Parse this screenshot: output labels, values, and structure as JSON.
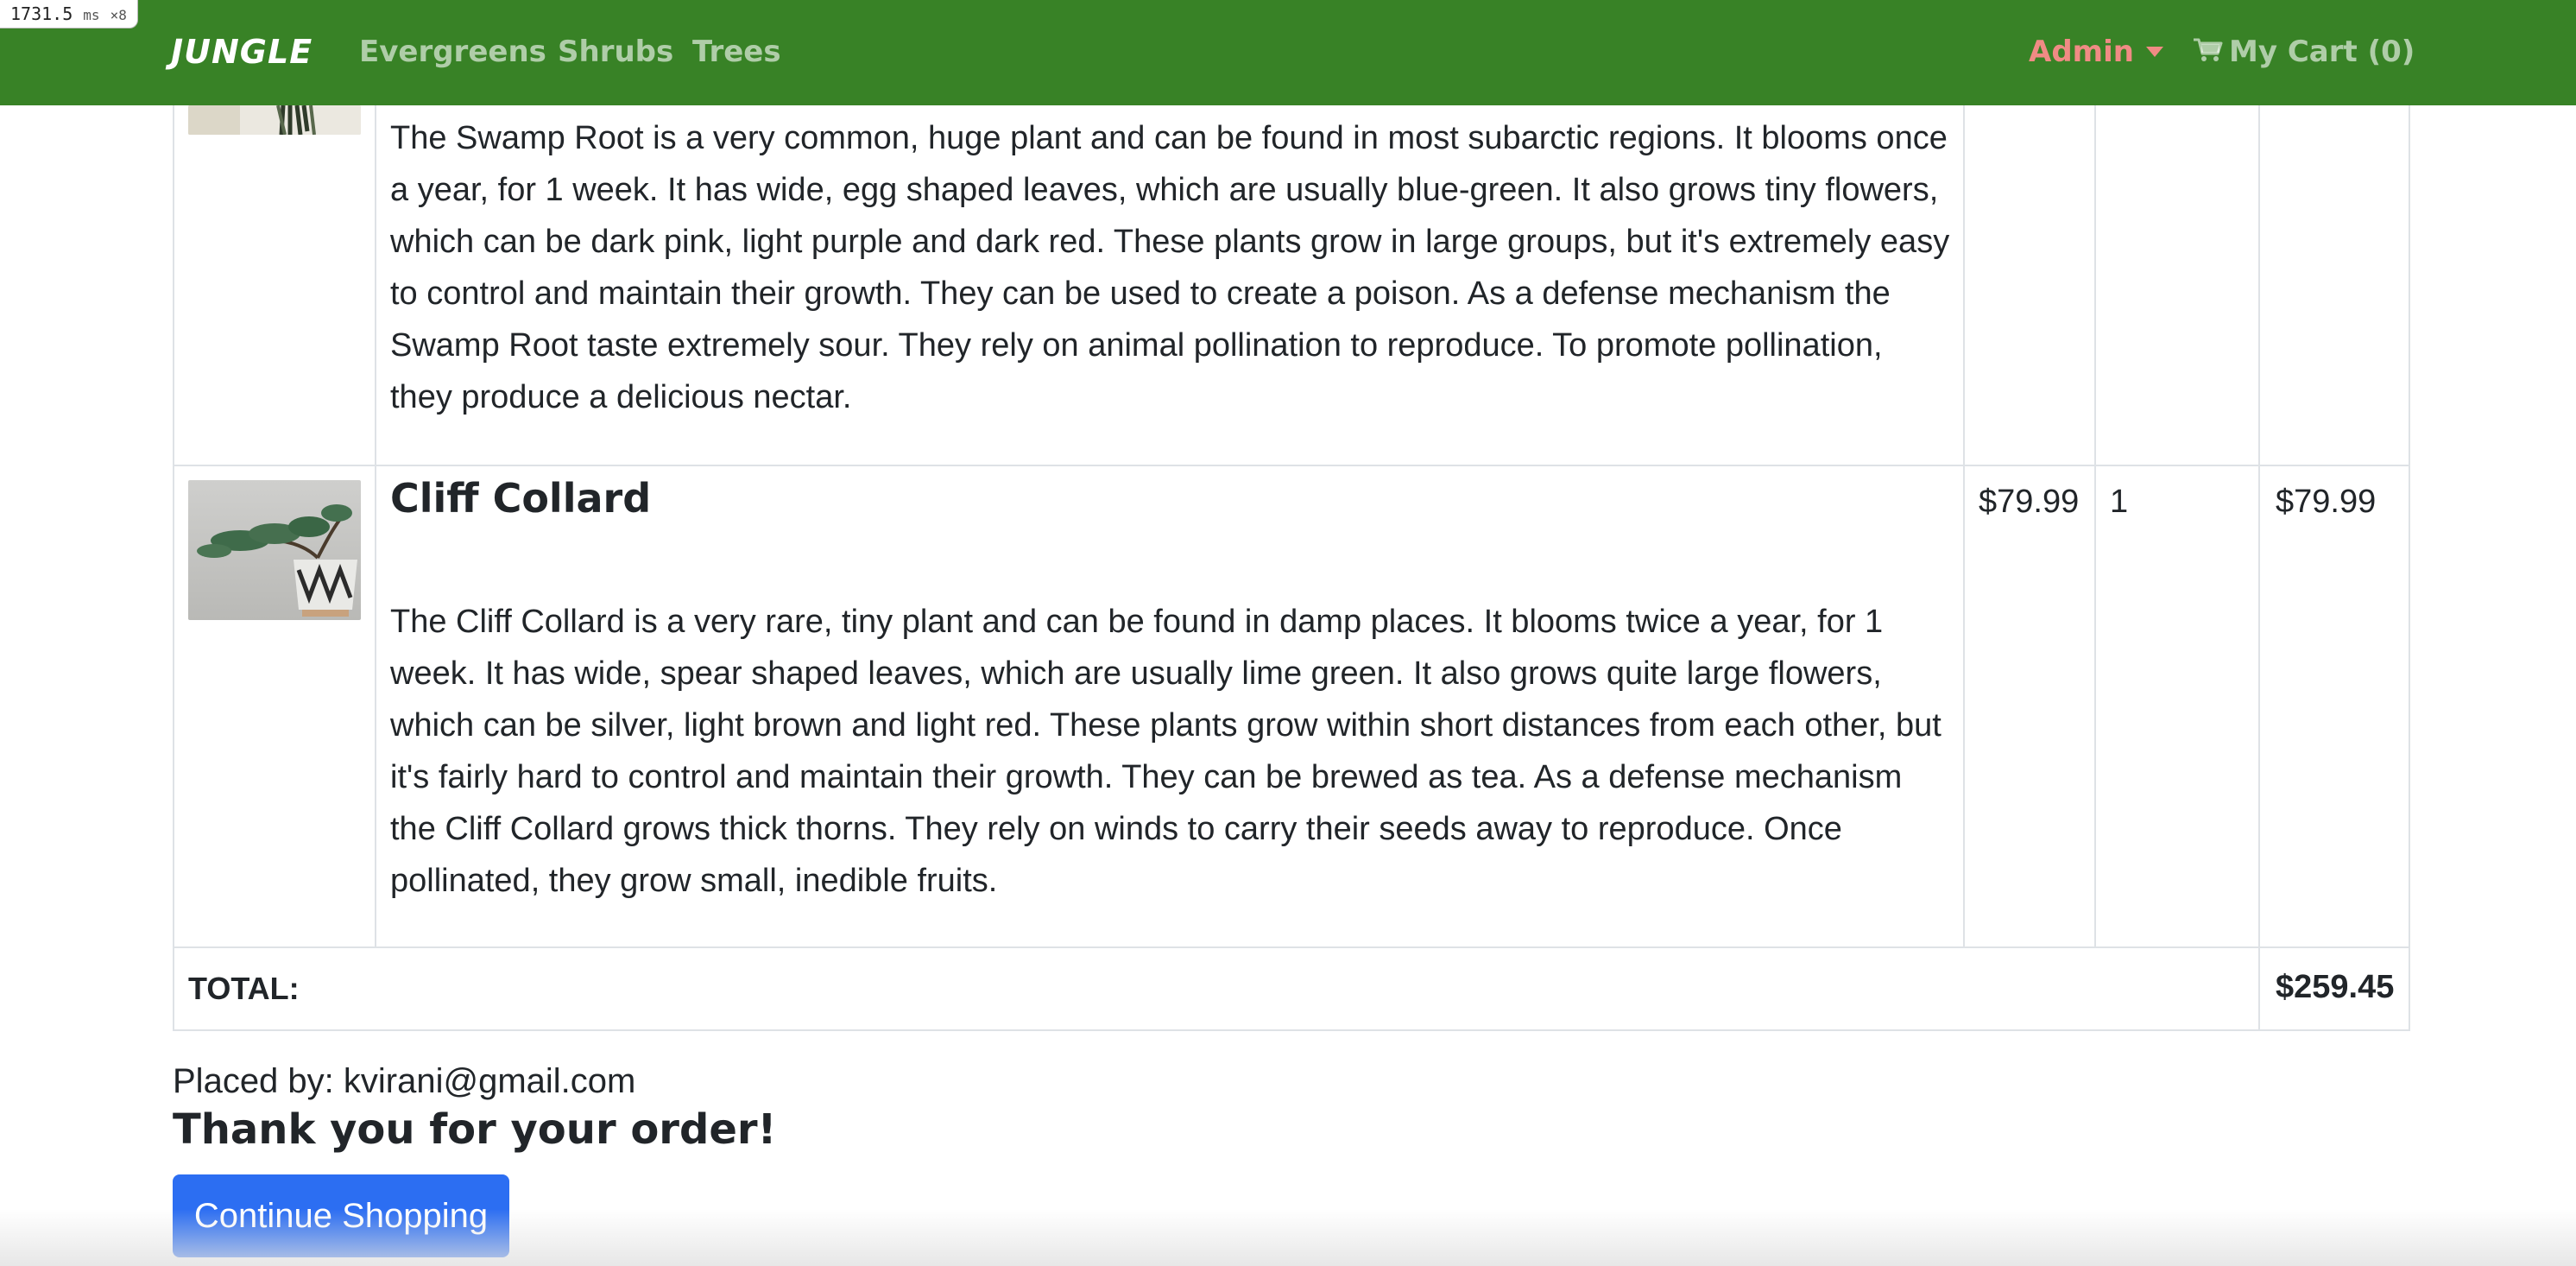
{
  "timing": {
    "value": "1731.5",
    "unit": "ms",
    "multiplier": "×8"
  },
  "navbar": {
    "brand": "JUNGLE",
    "links": [
      "Evergreens",
      "Shrubs",
      "Trees"
    ],
    "admin_label": "Admin",
    "cart_label": "My Cart (0)"
  },
  "order": {
    "items": [
      {
        "description": "The Swamp Root is a very common, huge plant and can be found in most subarctic regions. It blooms once a year, for 1 week. It has wide, egg shaped leaves, which are usually blue-green. It also grows tiny flowers, which can be dark pink, light purple and dark red. These plants grow in large groups, but it's extremely easy to control and maintain their growth. They can be used to create a poison. As a defense mechanism the Swamp Root taste extremely sour. They rely on animal pollination to reproduce. To promote pollination, they produce a delicious nectar."
      },
      {
        "name": "Cliff Collard",
        "description": "The Cliff Collard is a very rare, tiny plant and can be found in damp places. It blooms twice a year, for 1 week. It has wide, spear shaped leaves, which are usually lime green. It also grows quite large flowers, which can be silver, light brown and light red. These plants grow within short distances from each other, but it's fairly hard to control and maintain their growth. They can be brewed as tea. As a defense mechanism the Cliff Collard grows thick thorns. They rely on winds to carry their seeds away to reproduce. Once pollinated, they grow small, inedible fruits.",
        "price": "$79.99",
        "quantity": "1",
        "line_total": "$79.99"
      }
    ],
    "total_label": "TOTAL:",
    "total_value": "$259.45",
    "placed_by": "Placed by: kvirani@gmail.com",
    "thank_you": "Thank you for your order!",
    "continue_button": "Continue Shopping"
  },
  "colors": {
    "navbar": "#388226",
    "admin": "#f08b84",
    "button": "#2c6ef2"
  }
}
